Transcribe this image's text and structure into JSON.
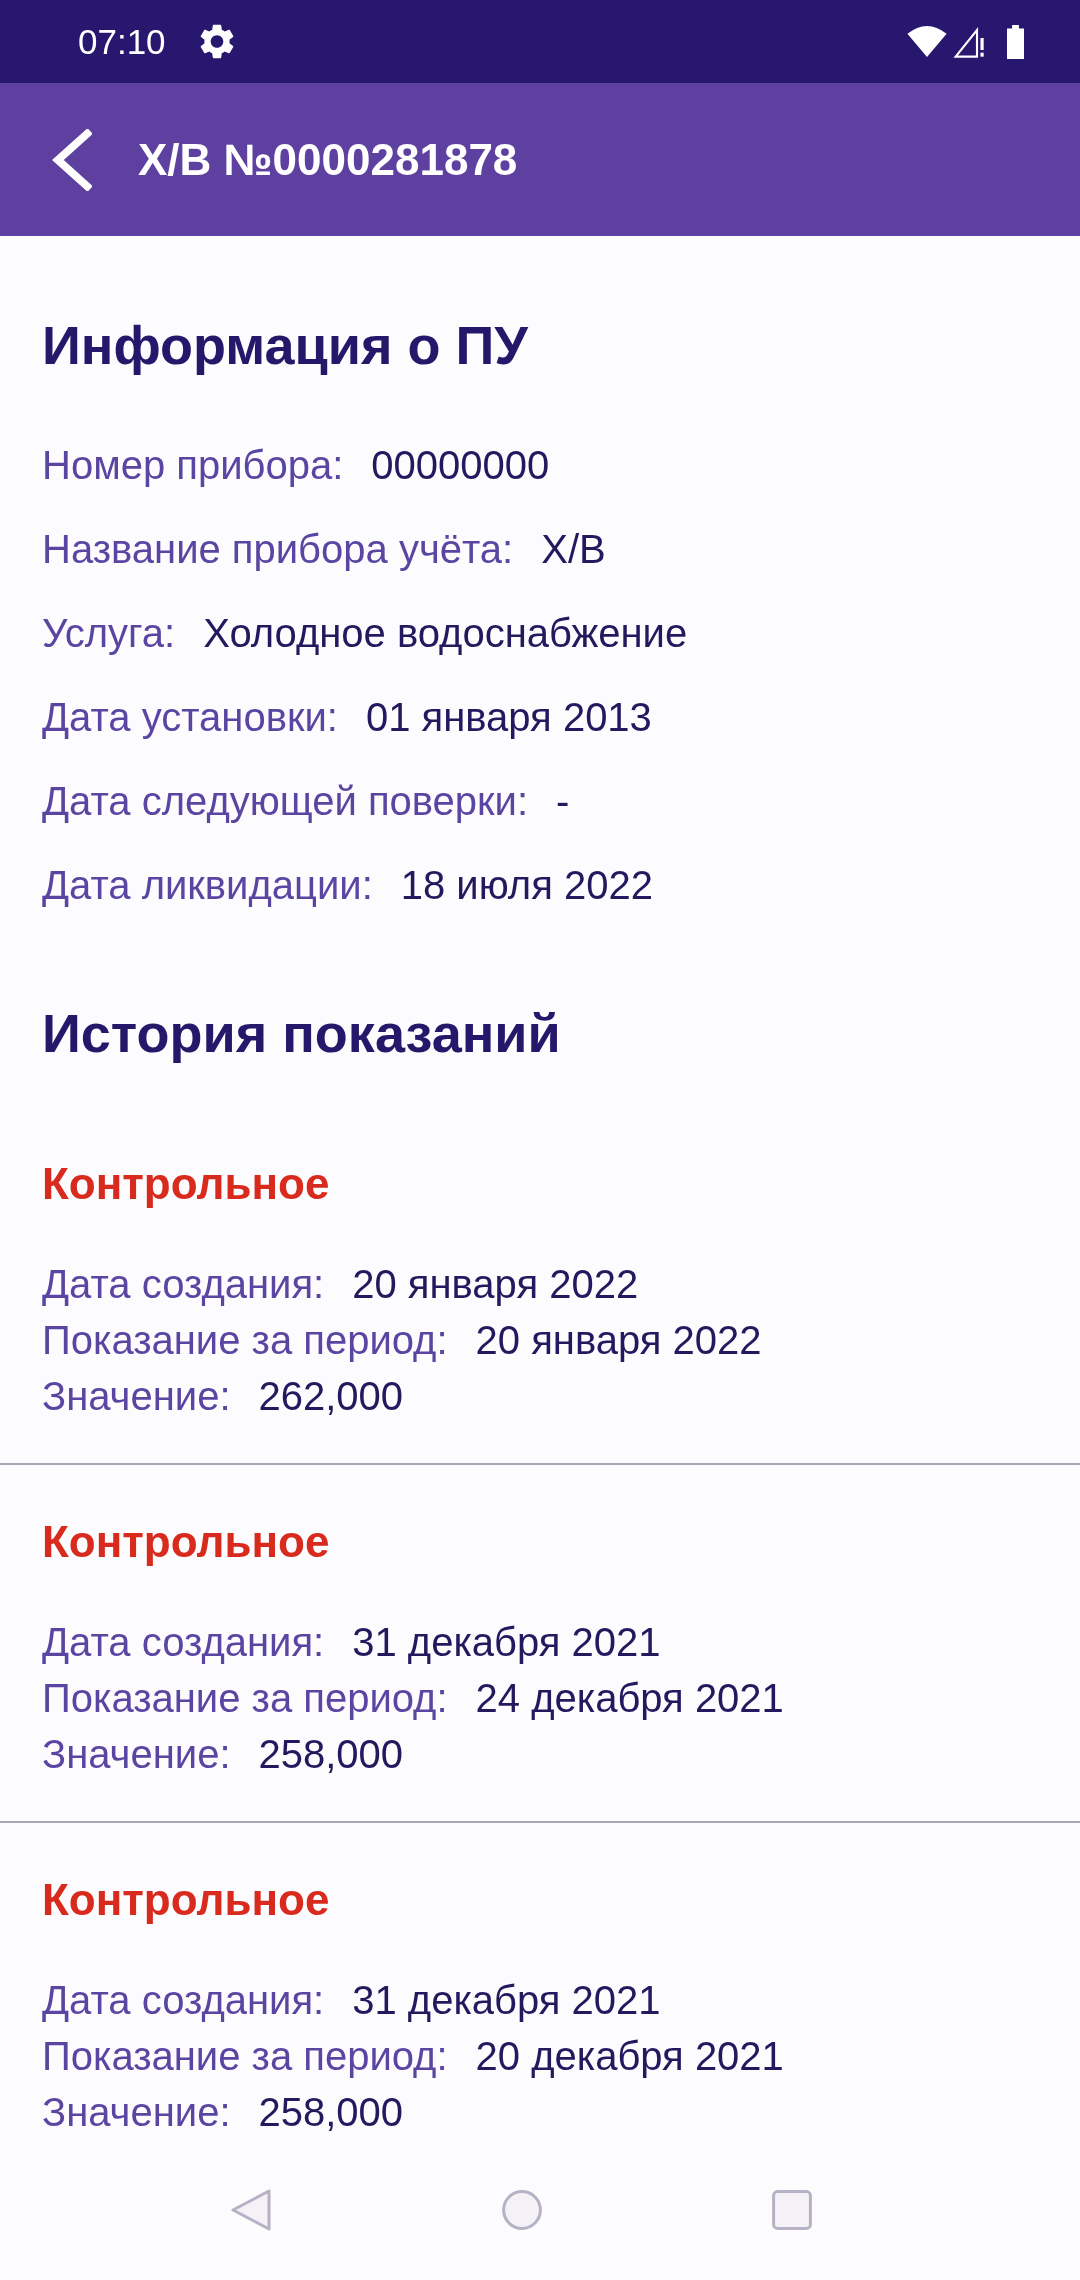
{
  "status_bar": {
    "time": "07:10"
  },
  "app_bar": {
    "title": "Х/В №0000281878"
  },
  "device_info": {
    "title": "Информация о ПУ",
    "fields": [
      {
        "label": "Номер прибора:",
        "value": "00000000"
      },
      {
        "label": "Название прибора учёта:",
        "value": "Х/В"
      },
      {
        "label": "Услуга:",
        "value": "Холодное водоснабжение"
      },
      {
        "label": "Дата установки:",
        "value": "01 января 2013"
      },
      {
        "label": "Дата следующей поверки:",
        "value": "-"
      },
      {
        "label": "Дата ликвидации:",
        "value": "18 июля 2022"
      }
    ]
  },
  "readings_history": {
    "title": "История показаний",
    "readings": [
      {
        "type": "Контрольное",
        "fields": [
          {
            "label": "Дата создания:",
            "value": "20 января 2022"
          },
          {
            "label": "Показание за период:",
            "value": "20 января 2022"
          },
          {
            "label": "Значение:",
            "value": "262,000"
          }
        ]
      },
      {
        "type": "Контрольное",
        "fields": [
          {
            "label": "Дата создания:",
            "value": "31 декабря 2021"
          },
          {
            "label": "Показание за период:",
            "value": "24 декабря 2021"
          },
          {
            "label": "Значение:",
            "value": "258,000"
          }
        ]
      },
      {
        "type": "Контрольное",
        "fields": [
          {
            "label": "Дата создания:",
            "value": "31 декабря 2021"
          },
          {
            "label": "Показание за период:",
            "value": "20 декабря 2021"
          },
          {
            "label": "Значение:",
            "value": "258,000"
          }
        ]
      }
    ]
  }
}
